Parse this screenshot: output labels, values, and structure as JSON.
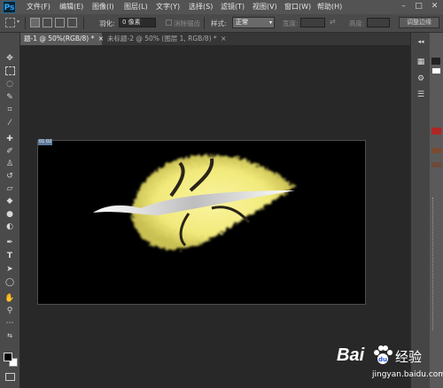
{
  "app": {
    "logo": "Ps"
  },
  "menu": [
    "文件(F)",
    "编辑(E)",
    "图像(I)",
    "图层(L)",
    "文字(Y)",
    "选择(S)",
    "滤镜(T)",
    "视图(V)",
    "窗口(W)",
    "帮助(H)"
  ],
  "window_controls": {
    "minimize": "–",
    "maximize": "□",
    "close": "✕"
  },
  "options": {
    "feather_label": "羽化:",
    "feather_value": "0 像素",
    "antialias_label": "消除锯齿",
    "style_label": "样式:",
    "style_value": "正常",
    "width_label": "宽度:",
    "height_label": "高度:",
    "refine_edge_button": "调整边缘"
  },
  "tabs": [
    {
      "label": "题-1 @ 50%(RGB/8) *",
      "close": "×"
    },
    {
      "label": "未标题-2 @ 50% (图层 1, RGB/8) *",
      "close": "×"
    }
  ],
  "canvas": {
    "corner_label": "01 02"
  },
  "watermark": {
    "logo_text": "Bai",
    "logo_suffix": "经验",
    "url": "jingyan.baidu.com"
  },
  "colors": {
    "leaf": "#f3ee86",
    "vein": "#3a2f1a",
    "canvas": "#000000",
    "watermark": "#ffffff"
  }
}
